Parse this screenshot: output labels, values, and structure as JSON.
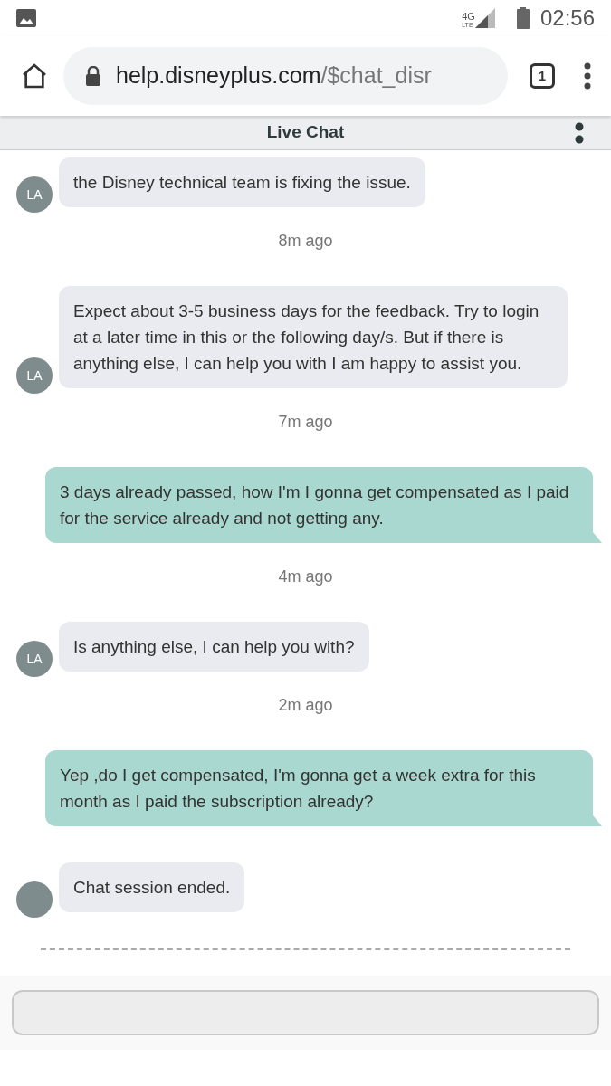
{
  "status_bar": {
    "network": "4G",
    "network_sub": "LTE",
    "time": "02:56"
  },
  "browser": {
    "url_host": "help.disneyplus.com",
    "url_path": "/$chat_disr",
    "tab_count": "1"
  },
  "header": {
    "title": "Live Chat"
  },
  "messages": [
    {
      "kind": "agent",
      "avatar": "LA",
      "text": "the Disney technical team is fixing the issue."
    },
    {
      "kind": "time",
      "text": "8m ago"
    },
    {
      "kind": "agent",
      "avatar": "LA",
      "text": "Expect about 3-5 business days for the feedback. Try to login at a later time in this or the following day/s. But if there is anything else, I can help you with I am happy to assist you."
    },
    {
      "kind": "time",
      "text": "7m ago"
    },
    {
      "kind": "user",
      "text": "3 days already passed, how I'm I gonna get compensated as I paid for the service already and not getting any."
    },
    {
      "kind": "time",
      "text": "4m ago"
    },
    {
      "kind": "agent",
      "avatar": "LA",
      "text": "Is anything else, I can help you with?"
    },
    {
      "kind": "time",
      "text": "2m ago"
    },
    {
      "kind": "user",
      "text": "Yep ,do I get compensated, I'm gonna get a week extra for this month as I paid the subscription already?"
    },
    {
      "kind": "agent",
      "text": "Chat session ended."
    }
  ]
}
